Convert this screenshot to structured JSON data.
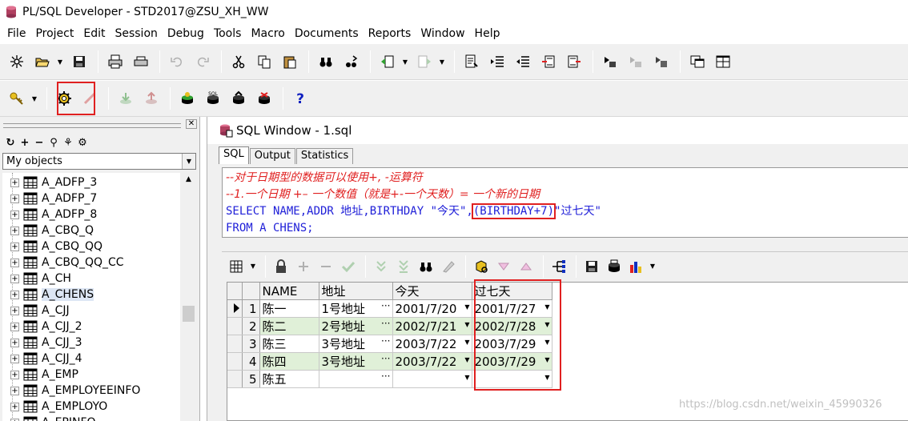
{
  "window": {
    "title": "PL/SQL Developer - STD2017@ZSU_XH_WW"
  },
  "menu": [
    "File",
    "Project",
    "Edit",
    "Session",
    "Debug",
    "Tools",
    "Macro",
    "Documents",
    "Reports",
    "Window",
    "Help"
  ],
  "left_panel": {
    "selector": "My objects",
    "tree": [
      "A_ADFP_3",
      "A_ADFP_7",
      "A_ADFP_8",
      "A_CBQ_Q",
      "A_CBQ_QQ",
      "A_CBQ_QQ_CC",
      "A_CH",
      "A_CHENS",
      "A_CJJ",
      "A_CJJ_2",
      "A_CJJ_3",
      "A_CJJ_4",
      "A_EMP",
      "A_EMPLOYEEINFO",
      "A_EMPLOYO",
      "A_EPINFO"
    ],
    "selected": "A_CHENS"
  },
  "sql_window": {
    "title": "SQL Window - 1.sql",
    "tabs": [
      "SQL",
      "Output",
      "Statistics"
    ],
    "editor": {
      "comment1": "--对于日期型的数据可以使用+, -运算符",
      "comment2": "--1.一个日期 +– 一个数值（就是+-一个天数）= 一个新的日期",
      "sel_a": "SELECT NAME,ADDR 地址,BIRTHDAY \"今天\",",
      "sel_b": "(BIRTHDAY+7)",
      "sel_c": "\"过七天\"",
      "from": "FROM A CHENS;"
    },
    "grid": {
      "columns": [
        "NAME",
        "地址",
        "今天",
        "过七天"
      ],
      "rows": [
        {
          "rn": "1",
          "name": "陈一",
          "addr": "1号地址",
          "today": "2001/7/20",
          "plus7": "2001/7/27"
        },
        {
          "rn": "2",
          "name": "陈二",
          "addr": "2号地址",
          "today": "2002/7/21",
          "plus7": "2002/7/28"
        },
        {
          "rn": "3",
          "name": "陈三",
          "addr": "3号地址",
          "today": "2003/7/22",
          "plus7": "2003/7/29"
        },
        {
          "rn": "4",
          "name": "陈四",
          "addr": "3号地址",
          "today": "2003/7/22",
          "plus7": "2003/7/29"
        },
        {
          "rn": "5",
          "name": "陈五",
          "addr": "",
          "today": "",
          "plus7": ""
        }
      ]
    }
  },
  "watermark": "https://blog.csdn.net/weixin_45990326",
  "colors": {
    "highlight": "#e02020",
    "keyword": "#2020d8",
    "comment": "#e02020",
    "row_fill": "#e0f0d8"
  }
}
